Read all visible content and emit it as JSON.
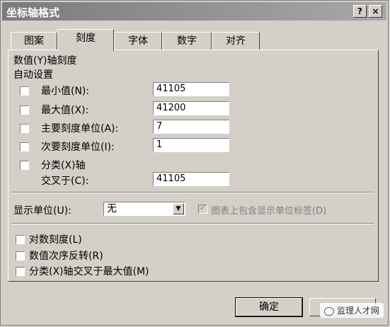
{
  "window": {
    "title": "坐标轴格式",
    "help_label": "?",
    "close_label": "×"
  },
  "tabs": [
    {
      "label": "图案",
      "active": false
    },
    {
      "label": "刻度",
      "active": true
    },
    {
      "label": "字体",
      "active": false
    },
    {
      "label": "数字",
      "active": false
    },
    {
      "label": "对齐",
      "active": false
    }
  ],
  "scale": {
    "section_title": "数值(Y)轴刻度",
    "auto_label": "自动设置",
    "min_label": "最小值(N):",
    "min_value": "41105",
    "max_label": "最大值(X):",
    "max_value": "41200",
    "major_label": "主要刻度单位(A):",
    "major_value": "7",
    "minor_label": "次要刻度单位(I):",
    "minor_value": "1",
    "category_label": "分类(X)轴",
    "cross_label": "交叉于(C):",
    "cross_value": "41105"
  },
  "display_units": {
    "label": "显示单位(U):",
    "value": "无",
    "show_label_text": "图表上包含显示单位标签(D)"
  },
  "options": {
    "log_label": "对数刻度(L)",
    "reverse_label": "数值次序反转(R)",
    "cross_max_label": "分类(X)轴交叉于最大值(M)"
  },
  "buttons": {
    "ok_label": "确定"
  },
  "watermark": {
    "text": "监理人才网"
  }
}
